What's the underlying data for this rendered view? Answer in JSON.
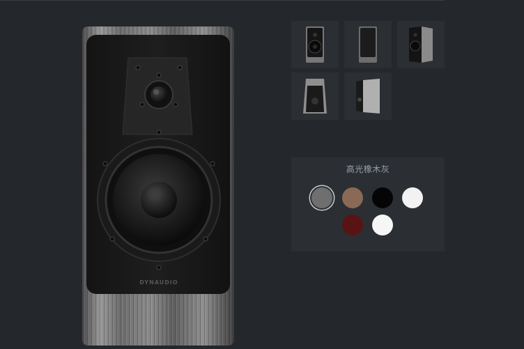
{
  "product": {
    "brand_mark": "DYNAUDIO",
    "image_name": "bookshelf-speaker"
  },
  "gallery": {
    "thumbnails": [
      {
        "name": "front-view"
      },
      {
        "name": "front-grille-view"
      },
      {
        "name": "angled-view"
      },
      {
        "name": "top-view"
      },
      {
        "name": "side-view"
      }
    ]
  },
  "finish_selector": {
    "selected_label": "高光橡木灰",
    "swatches": [
      {
        "name": "grey-oak",
        "color": "#6f6f6f",
        "selected": true
      },
      {
        "name": "walnut",
        "color": "#8a6a55",
        "selected": false
      },
      {
        "name": "black",
        "color": "#050505",
        "selected": false
      },
      {
        "name": "white",
        "color": "#f2f2f2",
        "selected": false
      },
      {
        "name": "red-gloss",
        "color": "#5a1313",
        "selected": false
      },
      {
        "name": "white-satin",
        "color": "#f6f6f6",
        "selected": false
      }
    ]
  }
}
